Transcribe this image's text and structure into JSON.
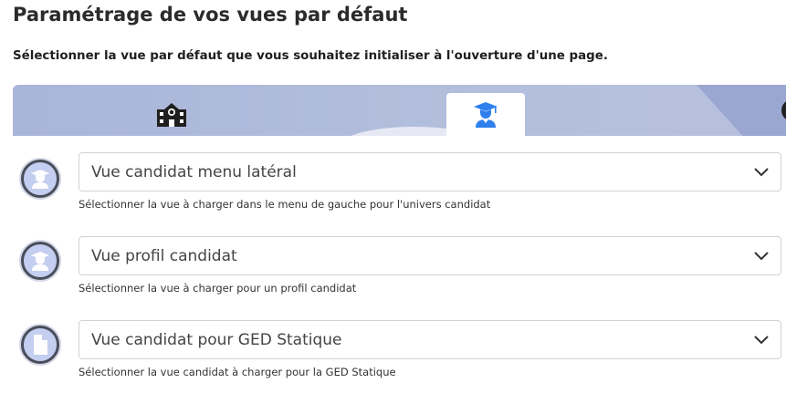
{
  "header": {
    "title": "Paramétrage de vos vues par défaut",
    "subtitle": "Sélectionner la vue par défaut que vous souhaitez initialiser à l'ouverture d'une page."
  },
  "tabs": [
    {
      "icon": "school-building-icon",
      "active": false
    },
    {
      "icon": "graduate-cap-icon",
      "active": true
    }
  ],
  "colors": {
    "accent": "#2f80ed",
    "banner": "#b1bcdc",
    "icon_dark": "#1f1f1f"
  },
  "settings": [
    {
      "icon": "candidate-avatar-icon",
      "value": "Vue candidat menu latéral",
      "helper": "Sélectionner la vue à charger dans le menu de gauche pour l'univers candidat"
    },
    {
      "icon": "candidate-avatar-icon",
      "value": "Vue profil candidat",
      "helper": "Sélectionner la vue à charger pour un profil candidat"
    },
    {
      "icon": "document-icon",
      "value": "Vue candidat pour GED Statique",
      "helper": "Sélectionner la vue candidat à charger pour la GED Statique"
    }
  ]
}
